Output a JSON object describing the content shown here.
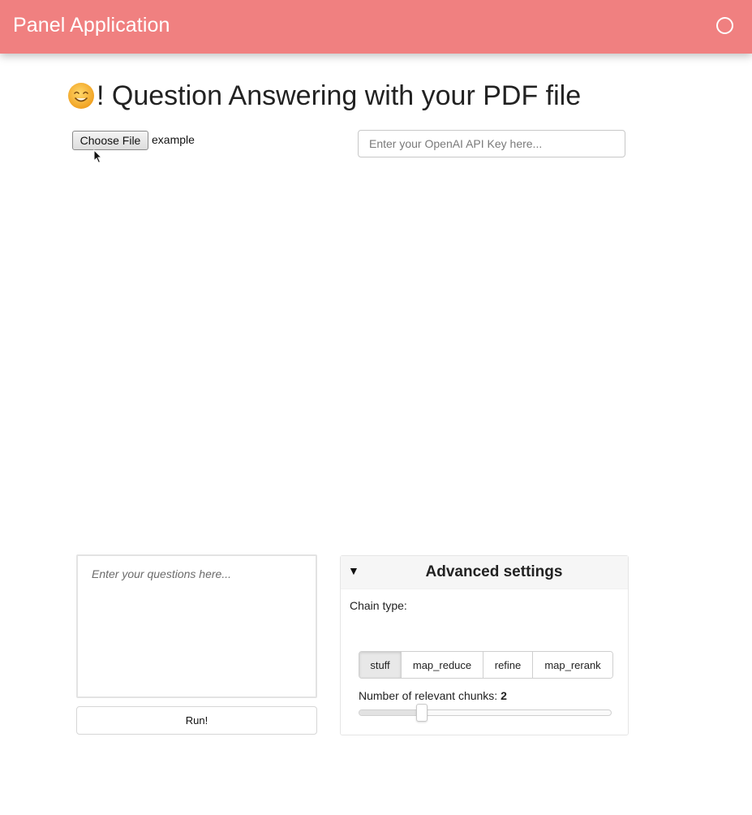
{
  "header": {
    "title": "Panel Application",
    "busy_icon": "circle-outline-icon"
  },
  "main": {
    "title_emoji": "smiling-face-icon",
    "title": "! Question Answering with your PDF file",
    "file_button_label": "Choose File",
    "file_name": "example",
    "api_key_placeholder": "Enter your OpenAI API Key here..."
  },
  "query": {
    "placeholder": "Enter your questions here...",
    "run_label": "Run!"
  },
  "advanced": {
    "title": "Advanced settings",
    "toggle_icon": "caret-down-icon",
    "chain_type_label": "Chain type:",
    "chain_options": [
      "stuff",
      "map_reduce",
      "refine",
      "map_rerank"
    ],
    "chain_selected": "stuff",
    "chunks_label": "Number of relevant chunks:",
    "chunks_value": "2"
  },
  "colors": {
    "header_bg": "#f08080"
  }
}
